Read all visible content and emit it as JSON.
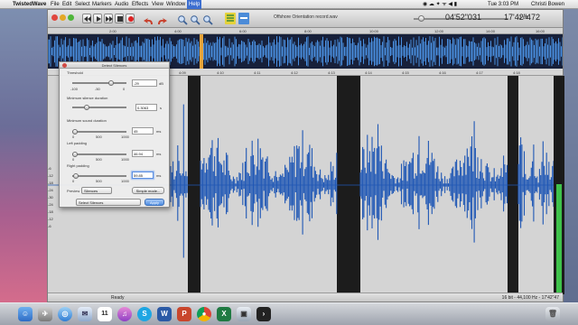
{
  "menubar": {
    "app_name": "TwistedWave",
    "items": [
      "File",
      "Edit",
      "Select",
      "Markers",
      "Audio",
      "Effects",
      "View",
      "Window",
      "Help"
    ],
    "clock": "Tue 3:03 PM",
    "user": "Christi Bowen"
  },
  "window": {
    "title": "Offshore Orientation record.wav",
    "cursor_time": "04'52\"031",
    "total_time": "17'42\"472",
    "volume_label": "-3 dB"
  },
  "overview_ruler": {
    "ticks": [
      "2:00",
      "4:00",
      "6:00",
      "8:00",
      "10:00",
      "12:00",
      "14:00",
      "16:00"
    ]
  },
  "ruler": {
    "ticks": [
      "4:09",
      "4:10",
      "4:11",
      "4:12",
      "4:13",
      "4:14",
      "4:15",
      "4:16",
      "4:17",
      "4:18"
    ]
  },
  "db_scale": [
    "-6",
    "-12",
    "-18",
    "-24",
    "-30",
    "-24",
    "-18",
    "-12",
    "-6"
  ],
  "status": {
    "text": "Ready",
    "format": "16 bit - 44,100 Hz - 17'42\"47"
  },
  "dialog": {
    "title": "Detect Silences",
    "threshold": {
      "label": "Threshold",
      "value": "-29",
      "unit": "dB",
      "min": "-100",
      "mid": "-50",
      "max": "0",
      "level": 0.71
    },
    "min_silence": {
      "label": "Minimum silence duration",
      "value": "0.3063",
      "unit": "s",
      "level": 0.26
    },
    "min_sound": {
      "label": "Minimum sound duration",
      "value": "45",
      "unit": "ms",
      "min": "0",
      "mid": "500",
      "max": "1000",
      "level": 0.05
    },
    "left_padding": {
      "label": "Left padding",
      "value": "46.94",
      "unit": "ms",
      "min": "0",
      "mid": "500",
      "max": "1000",
      "level": 0.05
    },
    "right_padding": {
      "label": "Right padding",
      "value": "59.85",
      "unit": "ms",
      "min": "0",
      "mid": "500",
      "max": "1000",
      "level": 0.06
    },
    "preview_label": "Preview",
    "preview_option": "Silences",
    "simple_mode_label": "Simple mode...",
    "action_option": "Select Silences",
    "apply_label": "Apply"
  },
  "colors": {
    "waveform": "#1f57b5",
    "silence_marker": "#1c1c1c",
    "overview_bg": "#17203a",
    "accent": "#3d6fd0"
  },
  "dock": {
    "icons": [
      "finder-icon",
      "launchpad-icon",
      "safari-icon",
      "mail-icon",
      "calendar-icon",
      "itunes-icon",
      "skype-icon",
      "word-icon",
      "powerpoint-icon",
      "chrome-icon",
      "excel-icon",
      "preview-icon",
      "terminal-icon",
      "trash-icon"
    ],
    "calendar_day": "11"
  }
}
